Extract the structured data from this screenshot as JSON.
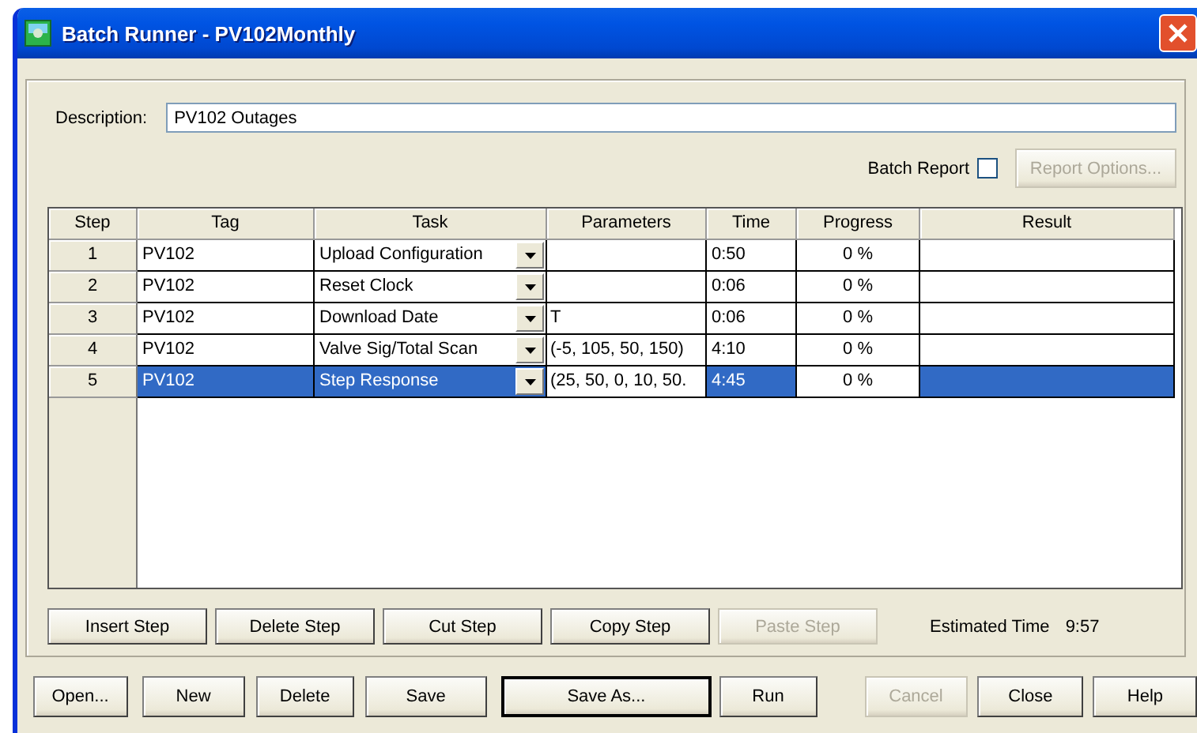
{
  "window": {
    "title": "Batch Runner - PV102Monthly"
  },
  "description": {
    "label": "Description:",
    "value": "PV102 Outages"
  },
  "batch_report": {
    "label": "Batch Report",
    "checked": false
  },
  "report_options_button": {
    "label": "Report Options...",
    "disabled": true
  },
  "table": {
    "columns": [
      "Step",
      "Tag",
      "Task",
      "Parameters",
      "Time",
      "Progress",
      "Result"
    ],
    "rows": [
      {
        "step": "1",
        "tag": "PV102",
        "task": "Upload Configuration",
        "time": "0:50",
        "progress": "0 %",
        "selected": false
      },
      {
        "step": "2",
        "tag": "PV102",
        "task": "Reset Clock",
        "time": "0:06",
        "progress": "0 %",
        "selected": false
      },
      {
        "step": "3",
        "tag": "PV102",
        "task": "Download Date",
        "parameters": "T",
        "time": "0:06",
        "progress": "0 %",
        "selected": false
      },
      {
        "step": "4",
        "tag": "PV102",
        "task": "Valve Sig/Total Scan",
        "parameters": "(-5, 105, 50, 150)",
        "time": "4:10",
        "progress": "0 %",
        "selected": false
      },
      {
        "step": "5",
        "tag": "PV102",
        "task": "Step Response",
        "parameters": "(25, 50, 0, 10, 50.",
        "time": "4:45",
        "progress": "0 %",
        "selected": true
      }
    ]
  },
  "step_buttons": [
    {
      "label": "Insert Step",
      "disabled": false
    },
    {
      "label": "Delete Step",
      "disabled": false
    },
    {
      "label": "Cut Step",
      "disabled": false
    },
    {
      "label": "Copy Step",
      "disabled": false
    },
    {
      "label": "Paste Step",
      "disabled": true
    }
  ],
  "estimated_time": {
    "label": "Estimated Time",
    "value": "9:57"
  },
  "buttons": [
    {
      "label": "Open...",
      "disabled": false,
      "default": false
    },
    {
      "label": "New",
      "disabled": false,
      "default": false
    },
    {
      "label": "Delete",
      "disabled": false,
      "default": false
    },
    {
      "label": "Save",
      "disabled": false,
      "default": false
    },
    {
      "label": "Save As...",
      "disabled": false,
      "default": true
    },
    {
      "label": "Run",
      "disabled": false,
      "default": false
    },
    {
      "label": "Cancel",
      "disabled": true,
      "default": false
    },
    {
      "label": "Close",
      "disabled": false,
      "default": false
    },
    {
      "label": "Help",
      "disabled": false,
      "default": false
    }
  ]
}
